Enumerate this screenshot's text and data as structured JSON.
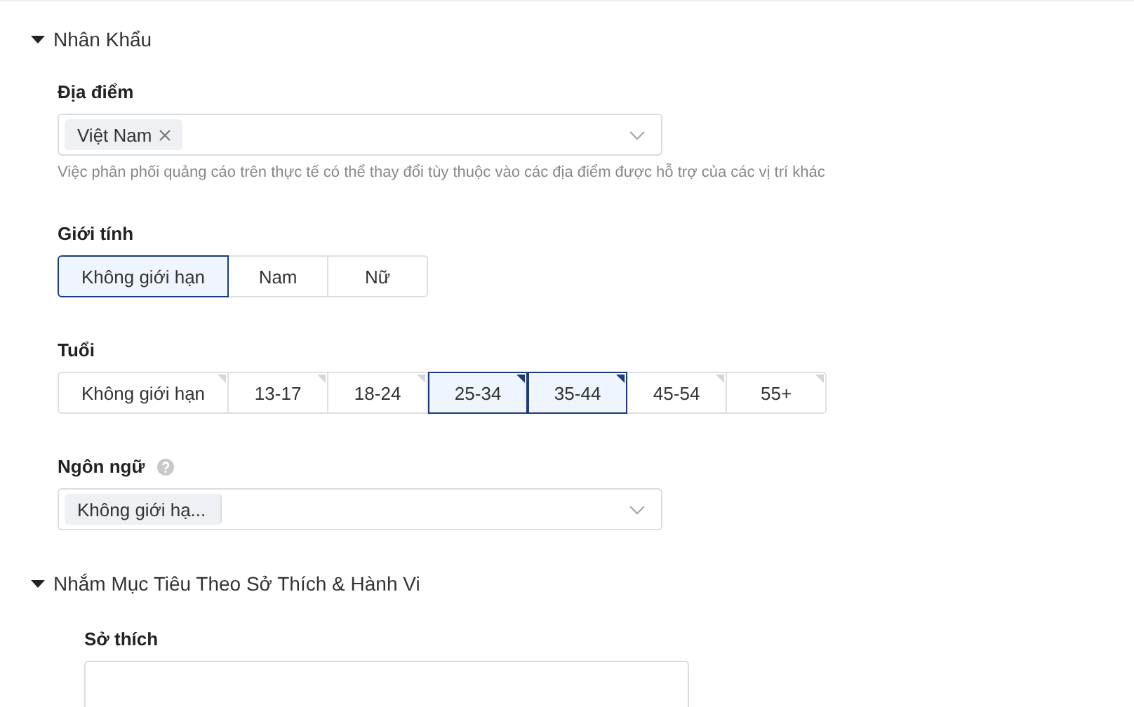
{
  "sections": [
    {
      "title": "Nhân Khẩu",
      "expanded": true,
      "fields": [
        {
          "kind": "select",
          "label": "Địa điểm",
          "tags": [
            {
              "text": "Việt Nam",
              "removable": true
            }
          ],
          "help": "Việc phân phối quảng cáo trên thực tế có thể thay đổi tùy thuộc vào các địa điểm được hỗ trợ của các vị trí khác"
        },
        {
          "kind": "segmented",
          "label": "Giới tính",
          "options": [
            {
              "label": "Không giới hạn",
              "selected": true
            },
            {
              "label": "Nam",
              "selected": false
            },
            {
              "label": "Nữ",
              "selected": false
            }
          ]
        },
        {
          "kind": "segmented",
          "label": "Tuổi",
          "corner_marks": true,
          "options": [
            {
              "label": "Không giới hạn",
              "selected": false
            },
            {
              "label": "13-17",
              "selected": false
            },
            {
              "label": "18-24",
              "selected": false
            },
            {
              "label": "25-34",
              "selected": true
            },
            {
              "label": "35-44",
              "selected": true
            },
            {
              "label": "45-54",
              "selected": false
            },
            {
              "label": "55+",
              "selected": false
            }
          ]
        },
        {
          "kind": "select",
          "label": "Ngôn ngữ",
          "info": true,
          "tags": [
            {
              "text": "Không giới hạ...",
              "removable": false
            }
          ]
        }
      ]
    },
    {
      "title": "Nhắm Mục Tiêu Theo Sở Thích & Hành Vi",
      "expanded": true,
      "indent": true,
      "fields": [
        {
          "kind": "select",
          "label": "Sở thích",
          "cut": true
        }
      ]
    }
  ]
}
